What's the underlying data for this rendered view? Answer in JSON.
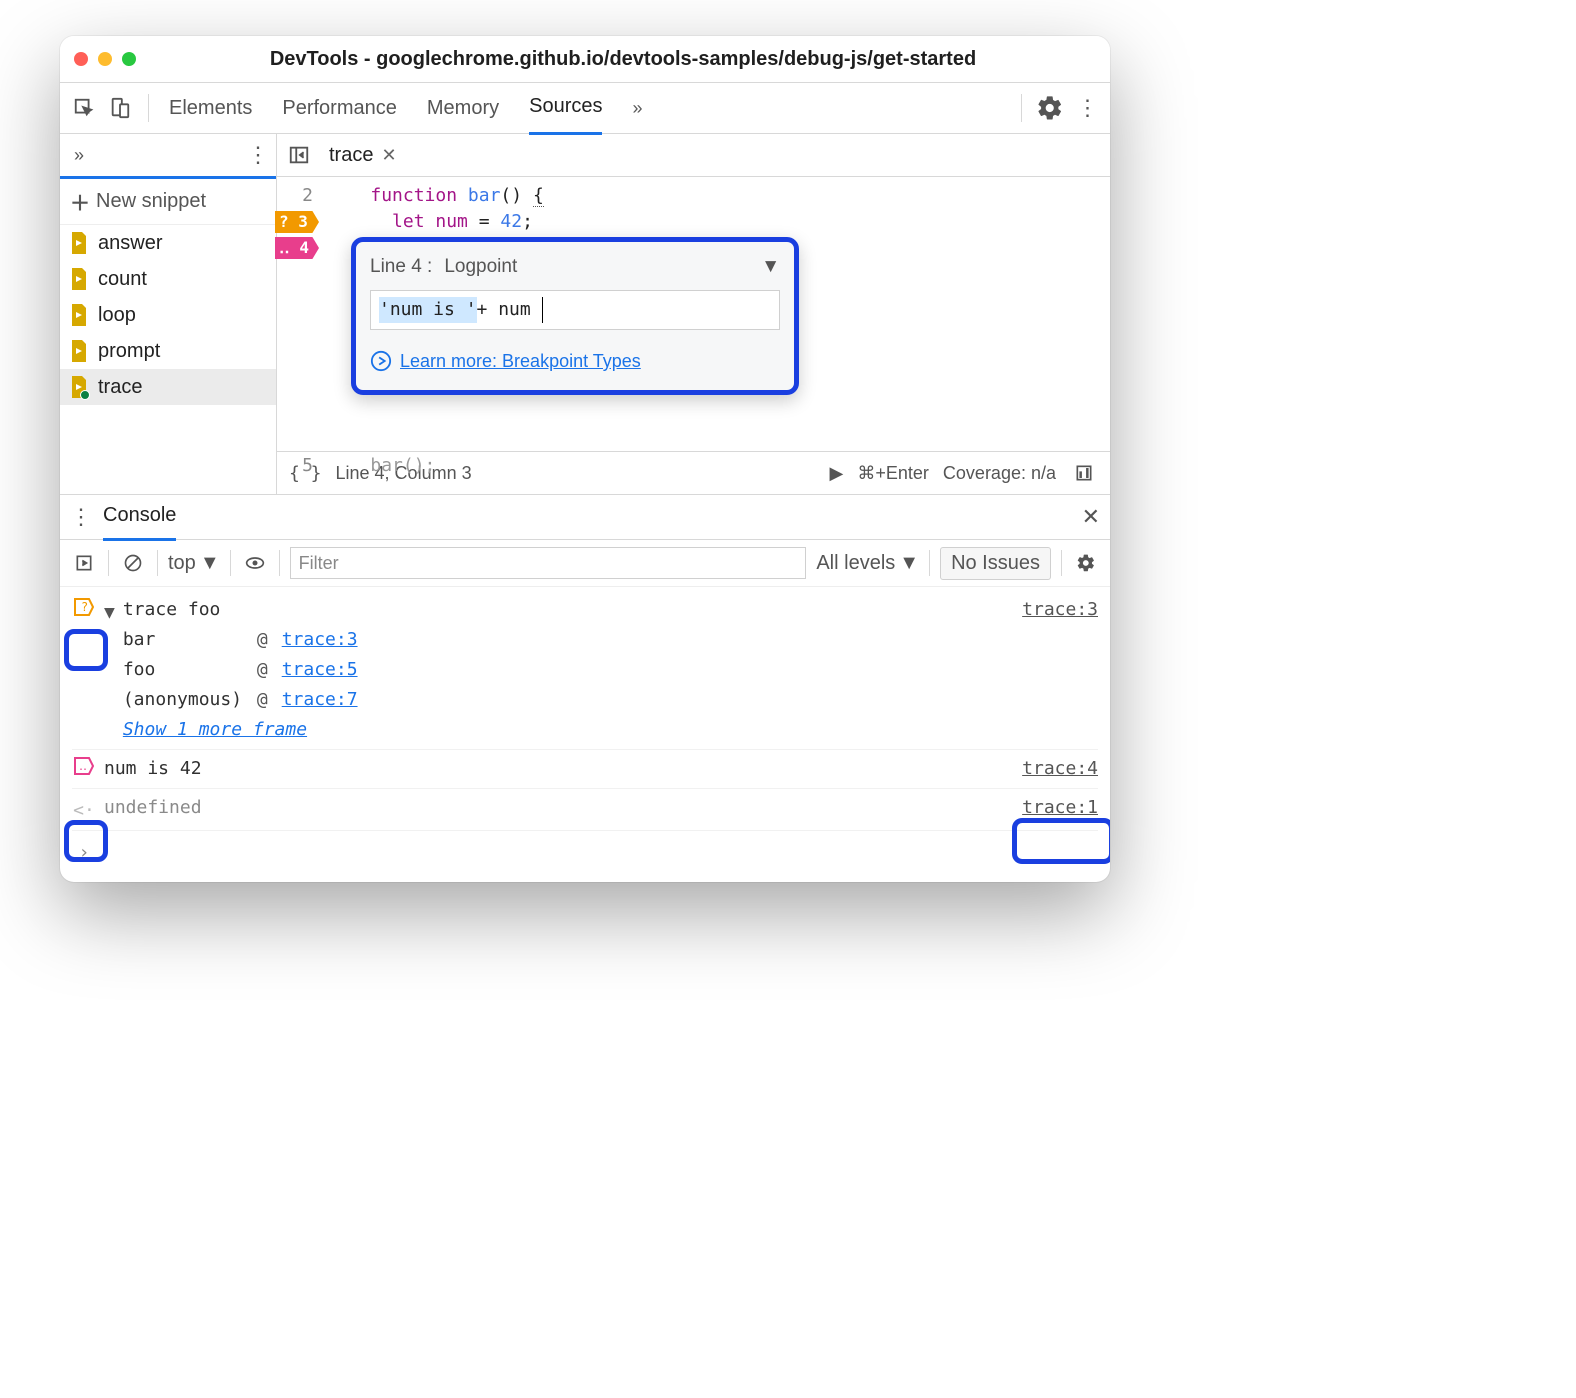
{
  "window": {
    "title": "DevTools - googlechrome.github.io/devtools-samples/debug-js/get-started"
  },
  "main_tabs": {
    "items": [
      "Elements",
      "Performance",
      "Memory",
      "Sources"
    ],
    "active": "Sources",
    "more": "»"
  },
  "sidebar": {
    "more": "»",
    "new_snippet_label": "New snippet",
    "items": [
      {
        "label": "answer"
      },
      {
        "label": "count"
      },
      {
        "label": "loop"
      },
      {
        "label": "prompt"
      },
      {
        "label": "trace",
        "selected": true,
        "modified": true
      }
    ]
  },
  "editor": {
    "tab_name": "trace",
    "lines": [
      {
        "n": 2,
        "code": {
          "pre": "    ",
          "kw": "function",
          "fn": " bar",
          "rest": "() ",
          "brace": "{"
        }
      },
      {
        "n": 3,
        "bp": "orange",
        "bp_char": "?",
        "code": {
          "pre": "      ",
          "kw": "let",
          "var": " num",
          "rest": " = ",
          "num": "42",
          "tail": ";"
        }
      },
      {
        "n": 4,
        "bp": "pink",
        "bp_char": "‥",
        "code": {
          "pre": "    ",
          "rest": "}"
        }
      },
      {
        "n": 5,
        "code": {
          "pre": "    ",
          "rest": "bar();"
        }
      }
    ],
    "popover": {
      "line_label": "Line 4 :",
      "type_label": "Logpoint",
      "expression_parts": {
        "hl": "'num is '",
        "rest": " + num"
      },
      "learn_more": "Learn more: Breakpoint Types"
    }
  },
  "statusbar": {
    "format_icon": "{ }",
    "cursor": "Line 4, Column 3",
    "run_hint": "⌘+Enter",
    "coverage": "Coverage: n/a"
  },
  "console_drawer": {
    "tab": "Console"
  },
  "console_toolbar": {
    "context": "top",
    "filter_placeholder": "Filter",
    "levels": "All levels",
    "issues": "No Issues"
  },
  "console": {
    "trace_msg": {
      "text": "trace foo",
      "src": "trace:3"
    },
    "stack": [
      {
        "fn": "bar",
        "ref": "trace:3"
      },
      {
        "fn": "foo",
        "ref": "trace:5"
      },
      {
        "fn": "(anonymous)",
        "ref": "trace:7"
      }
    ],
    "show_more": "Show 1 more frame",
    "logpoint": {
      "text": "num is 42",
      "src": "trace:4"
    },
    "return": {
      "text": "undefined",
      "src": "trace:1"
    }
  }
}
